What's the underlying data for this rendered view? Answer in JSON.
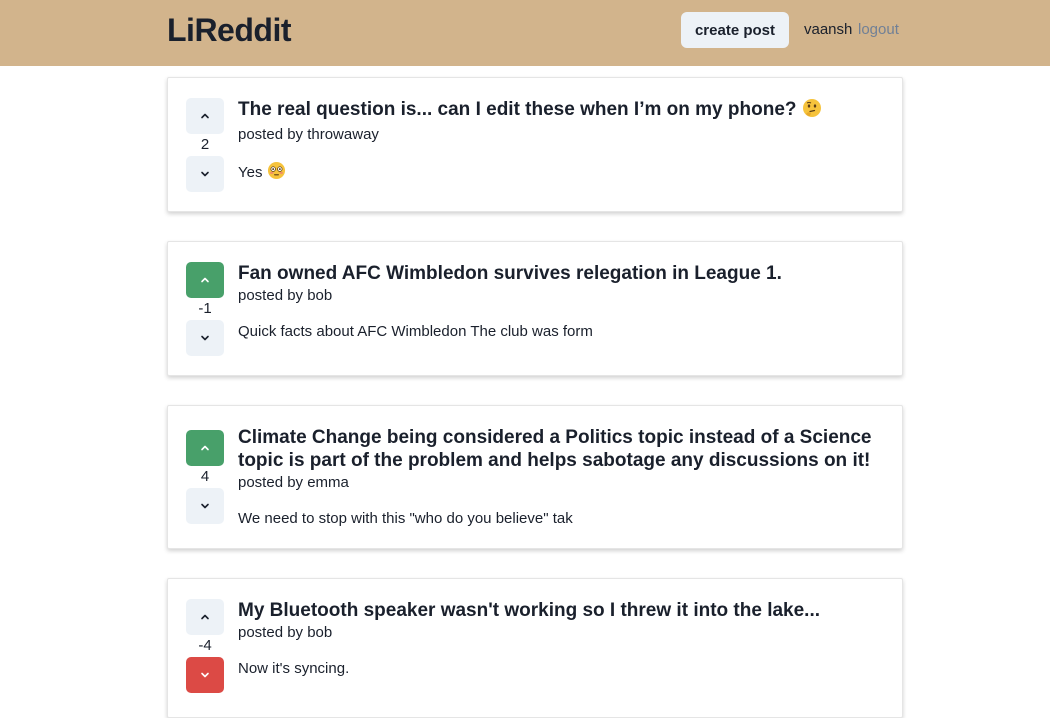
{
  "header": {
    "brand": "LiReddit",
    "create_post_label": "create post",
    "username": "vaansh",
    "logout_label": "logout"
  },
  "posts": [
    {
      "title": "The real question is... can I edit these when I’m on my phone?",
      "title_emoji": "thinking-face-emoji",
      "author_line": "posted by throwaway",
      "score": "2",
      "snippet": "Yes",
      "snippet_emoji": "flushed-face-emoji",
      "vote_state": "none"
    },
    {
      "title": "Fan owned AFC Wimbledon survives relegation in League 1.",
      "author_line": "posted by bob",
      "score": "-1",
      "snippet": "Quick facts about AFC Wimbledon The club was form",
      "vote_state": "up"
    },
    {
      "title": "Climate Change being considered a Politics topic instead of a Science topic is part of the problem and helps sabotage any discussions on it!",
      "author_line": "posted by emma",
      "score": "4",
      "snippet": "We need to stop with this \"who do you believe\" tak",
      "vote_state": "up"
    },
    {
      "title": "My Bluetooth speaker wasn't working so I threw it into the lake...",
      "author_line": "posted by bob",
      "score": "-4",
      "snippet": "Now it's syncing.",
      "vote_state": "down"
    }
  ],
  "colors": {
    "navbar": "#d2b48c",
    "upvote_active": "#48a06a",
    "downvote_active": "#dc4a45",
    "button_idle": "#edf2f7"
  }
}
